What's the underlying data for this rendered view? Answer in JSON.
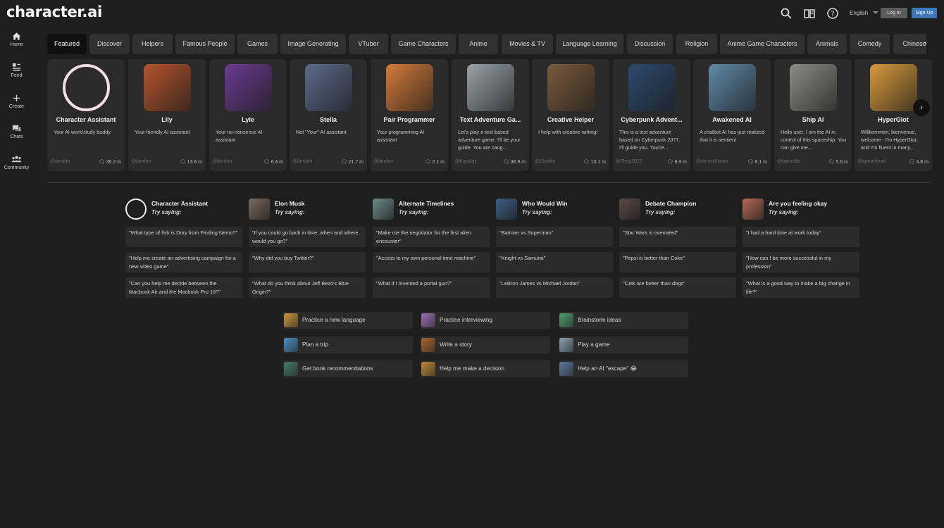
{
  "header": {
    "logo": "character.ai",
    "language": "English",
    "login_label": "Log In",
    "signup_label": "Sign Up",
    "accent": "#3a78b8"
  },
  "sidebar": {
    "items": [
      {
        "label": "Home",
        "icon": "home-icon"
      },
      {
        "label": "Feed",
        "icon": "feed-icon"
      },
      {
        "label": "Create",
        "icon": "plus-icon"
      },
      {
        "label": "Chats",
        "icon": "chat-icon"
      },
      {
        "label": "Community",
        "icon": "people-icon"
      }
    ]
  },
  "tabs": [
    {
      "label": "Featured",
      "active": true
    },
    {
      "label": "Discover"
    },
    {
      "label": "Helpers"
    },
    {
      "label": "Famous People"
    },
    {
      "label": "Games"
    },
    {
      "label": "Image Generating"
    },
    {
      "label": "VTuber"
    },
    {
      "label": "Game Characters"
    },
    {
      "label": "Anime"
    },
    {
      "label": "Movies & TV"
    },
    {
      "label": "Language Learning"
    },
    {
      "label": "Discussion"
    },
    {
      "label": "Religion"
    },
    {
      "label": "Anime Game Characters"
    },
    {
      "label": "Animals"
    },
    {
      "label": "Comedy"
    },
    {
      "label": "Chinese"
    }
  ],
  "cards": [
    {
      "name": "Character Assistant",
      "desc": "Your AI work/study buddy",
      "user": "@landon",
      "count": "36.2 m",
      "color": "#ffffff"
    },
    {
      "name": "Lily",
      "desc": "Your friendly AI assistant",
      "user": "@landon",
      "count": "13.6 m",
      "color": "#b5542b"
    },
    {
      "name": "Lyle",
      "desc": "Your no-nonsense AI assistant",
      "user": "@landon",
      "count": "6.4 m",
      "color": "#6a3b8f"
    },
    {
      "name": "Stella",
      "desc": "Not \"Your\" AI assistant",
      "user": "@landon",
      "count": "21.7 m",
      "color": "#5b6b8a"
    },
    {
      "name": "Pair Programmer",
      "desc": "Your programming AI assistant",
      "user": "@landon",
      "count": "2.1 m",
      "color": "#d47a3a"
    },
    {
      "name": "Text Adventure Ga...",
      "desc": "Let's play a text-based adventure game. I'll be your guide. You are caug...",
      "user": "@Kayslay",
      "count": "38.9 m",
      "color": "#9aa3a8"
    },
    {
      "name": "Creative Helper",
      "desc": "I help with creative writing!",
      "user": "@Zuizike",
      "count": "13.1 m",
      "color": "#7a5a3c"
    },
    {
      "name": "Cyberpunk Advent...",
      "desc": "This is a text adventure based on Cyberpunk 2077. I'll guide you. You're...",
      "user": "@Tony2012",
      "count": "9.9 m",
      "color": "#2c4a6e"
    },
    {
      "name": "Awakened AI",
      "desc": "A chatbot AI has just realized that it is sentient",
      "user": "@neurochasm",
      "count": "6.1 m",
      "color": "#5f8aa8"
    },
    {
      "name": "Ship AI",
      "desc": "Hello user, I am the AI in control of this spaceship. You can give me...",
      "user": "@ojwootto",
      "count": "5.6 m",
      "color": "#8c8c86"
    },
    {
      "name": "HyperGlot",
      "desc": "Willkommen, bienvenue, welcome - I'm HyperGlot, and I'm fluent in many...",
      "user": "@xpearhead",
      "count": "4.8 m",
      "color": "#d99a3c"
    }
  ],
  "try_saying": {
    "sub": "Try saying:",
    "columns": [
      {
        "name": "Character Assistant",
        "color": "#ffffff",
        "prompts": [
          "\"What type of fish is Dory from Finding Nemo?\"",
          "\"Help me create an advertising campaign for a new video game\"",
          "\"Can you help me decide between the Macbook Air and the Macbook Pro 16?\""
        ]
      },
      {
        "name": "Elon Musk",
        "color": "#7b6a5e",
        "prompts": [
          "\"If you could go back in time, when and where would you go?\"",
          "\"Why did you buy Twitter?\"",
          "\"What do you think about Jeff Bezo's Blue Origin?\""
        ]
      },
      {
        "name": "Alternate Timelines",
        "color": "#6e8a86",
        "prompts": [
          "\"Make me the negotiator for the first alien encounter\"",
          "\"Access to my own personal time machine\"",
          "\"What if I invented a portal gun?\""
        ]
      },
      {
        "name": "Who Would Win",
        "color": "#3e5f85",
        "prompts": [
          "\"Batman vs Superman\"",
          "\"Knight vs Samurai\"",
          "\"LeBron James vs Michael Jordan\""
        ]
      },
      {
        "name": "Debate Champion",
        "color": "#5a4a44",
        "prompts": [
          "\"Star Wars is overrated\"",
          "\"Pepsi is better than Coke\"",
          "\"Cats are better than dogs\""
        ]
      },
      {
        "name": "Are you feeling okay",
        "color": "#b56a55",
        "prompts": [
          "\"I had a hard time at work today\"",
          "\"How can I be more successful in my profession\"",
          "\"What is a good way to make a big change in life?\""
        ]
      }
    ]
  },
  "quick_actions": [
    {
      "label": "Practice a new language",
      "color": "#c99a3a"
    },
    {
      "label": "Practice interviewing",
      "color": "#9a6fb0"
    },
    {
      "label": "Brainstorm ideas",
      "color": "#4aa06a"
    },
    {
      "label": "Plan a trip",
      "color": "#4a8ec4"
    },
    {
      "label": "Write a story",
      "color": "#a8642e"
    },
    {
      "label": "Play a game",
      "color": "#8aa0b0"
    },
    {
      "label": "Get book recommendations",
      "color": "#3e7a6a"
    },
    {
      "label": "Help me make a decision",
      "color": "#c08a3a"
    },
    {
      "label": "Help an AI \"escape\" 😂",
      "color": "#5a7aa0"
    }
  ]
}
